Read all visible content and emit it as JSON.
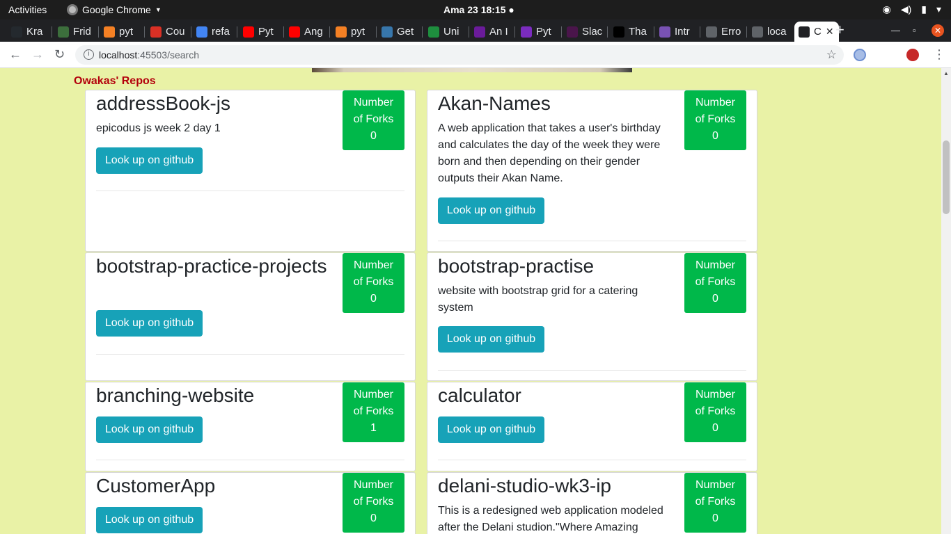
{
  "os_bar": {
    "activities": "Activities",
    "app_name": "Google Chrome",
    "clock": "Ama 23  18:15",
    "tray": [
      "wifi-icon",
      "volume-icon",
      "battery-icon",
      "power-menu-icon"
    ]
  },
  "browser": {
    "tabs": [
      {
        "label": "Kra",
        "icon": "github-icon",
        "color": "#24292e"
      },
      {
        "label": "Frid",
        "icon": "tree-icon",
        "color": "#3c6e3c"
      },
      {
        "label": "pyt",
        "icon": "stackoverflow-icon",
        "color": "#f48024"
      },
      {
        "label": "Cou",
        "icon": "gmail-icon",
        "color": "#d93025"
      },
      {
        "label": "refa",
        "icon": "google-icon",
        "color": "#4285f4"
      },
      {
        "label": "Pyt",
        "icon": "youtube-icon",
        "color": "#ff0000"
      },
      {
        "label": "Ang",
        "icon": "youtube-icon",
        "color": "#ff0000"
      },
      {
        "label": "pyt",
        "icon": "stackoverflow-icon",
        "color": "#f48024"
      },
      {
        "label": "Get",
        "icon": "python-icon",
        "color": "#3776ab"
      },
      {
        "label": "Uni",
        "icon": "infinity-icon",
        "color": "#1e8e3e"
      },
      {
        "label": "An I",
        "icon": "angular-icon",
        "color": "#6a1b9a"
      },
      {
        "label": "Pyt",
        "icon": "django-icon",
        "color": "#7b2cbf"
      },
      {
        "label": "Slac",
        "icon": "slack-icon",
        "color": "#4a154b"
      },
      {
        "label": "Tha",
        "icon": "jetbrains-icon",
        "color": "#000000"
      },
      {
        "label": "Intr",
        "icon": "bootstrap-icon",
        "color": "#7952b3"
      },
      {
        "label": "Erro",
        "icon": "error-icon",
        "color": "#5f6368"
      },
      {
        "label": "loca",
        "icon": "globe-icon",
        "color": "#5f6368"
      },
      {
        "label": "C",
        "icon": "angular-icon",
        "color": "#202124",
        "active": true
      }
    ],
    "url_host": "localhost",
    "url_rest": ":45503/search"
  },
  "page": {
    "section_title": "Owakas' Repos",
    "forks_label_1": "Number",
    "forks_label_2": "of Forks",
    "button_label": "Look up on github",
    "repos": [
      {
        "name": "addressBook-js",
        "description": "epicodus js week 2 day 1",
        "forks": "0"
      },
      {
        "name": "Akan-Names",
        "description": "A web application that takes a user's birthday and calculates the day of the week they were born and then depending on their gender outputs their Akan Name.",
        "forks": "0"
      },
      {
        "name": "bootstrap-practice-projects",
        "description": "",
        "forks": "0"
      },
      {
        "name": "bootstrap-practise",
        "description": "website with bootstrap grid for a catering system",
        "forks": "0"
      },
      {
        "name": "branching-website",
        "description": "",
        "forks": "1"
      },
      {
        "name": "calculator",
        "description": "",
        "forks": "0"
      },
      {
        "name": "CustomerApp",
        "description": "",
        "forks": "0"
      },
      {
        "name": "delani-studio-wk3-ip",
        "description": "This is a redesigned web application modeled after the Delani studion.\"Where Amazing",
        "forks": "0"
      }
    ]
  }
}
